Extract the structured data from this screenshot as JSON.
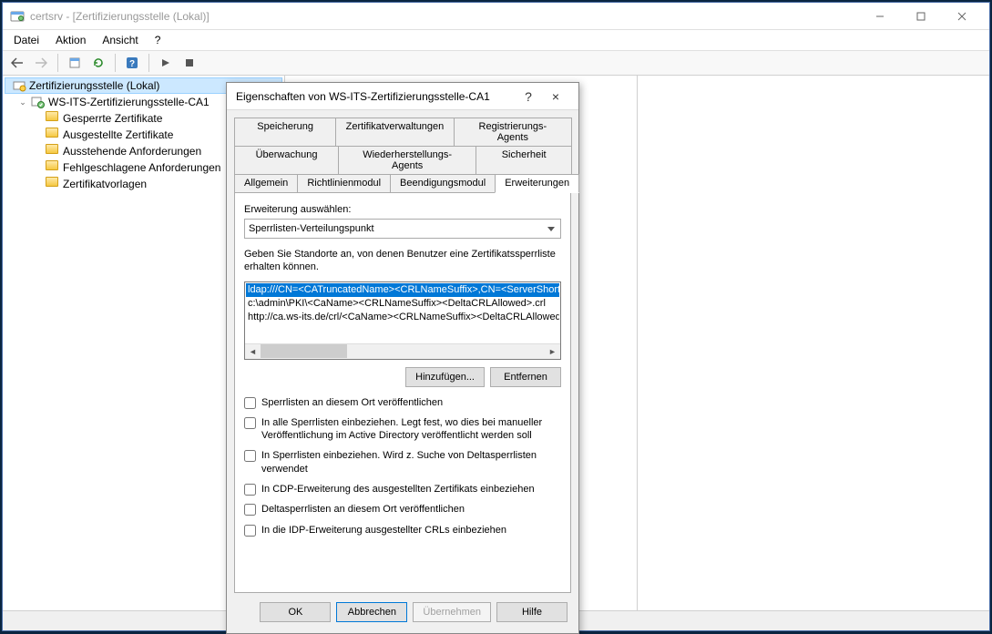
{
  "window": {
    "title_app": "certsrv",
    "title_doc": "[Zertifizierungsstelle (Lokal)]",
    "min_tip": "Minimieren",
    "max_tip": "Maximieren",
    "close_tip": "Schließen"
  },
  "menubar": {
    "file": "Datei",
    "action": "Aktion",
    "view": "Ansicht",
    "help": "?"
  },
  "tree": {
    "root": "Zertifizierungsstelle (Lokal)",
    "ca": "WS-ITS-Zertifizierungsstelle-CA1",
    "items": [
      "Gesperrte Zertifikate",
      "Ausgestellte Zertifikate",
      "Ausstehende Anforderungen",
      "Fehlgeschlagene Anforderungen",
      "Zertifikatvorlagen"
    ]
  },
  "dialog": {
    "title": "Eigenschaften von WS-ITS-Zertifizierungsstelle-CA1",
    "help_btn": "?",
    "close_btn": "×",
    "tabs_row1": [
      "Speicherung",
      "Zertifikatverwaltungen",
      "Registrierungs-Agents"
    ],
    "tabs_row2": [
      "Überwachung",
      "Wiederherstellungs-Agents",
      "Sicherheit"
    ],
    "tabs_row3": [
      "Allgemein",
      "Richtlinienmodul",
      "Beendigungsmodul",
      "Erweiterungen"
    ],
    "active_tab": "Erweiterungen",
    "ext_label": "Erweiterung auswählen:",
    "ext_combo_value": "Sperrlisten-Verteilungspunkt",
    "locations_label": "Geben Sie Standorte an, von denen Benutzer eine Zertifikatssperrliste erhalten können.",
    "list": [
      "ldap:///CN=<CATruncatedName><CRLNameSuffix>,CN=<ServerShortName>",
      "c:\\admin\\PKI\\<CaName><CRLNameSuffix><DeltaCRLAllowed>.crl",
      "http://ca.ws-its.de/crl/<CaName><CRLNameSuffix><DeltaCRLAllowed>.crl"
    ],
    "add_btn": "Hinzufügen...",
    "remove_btn": "Entfernen",
    "checks": [
      "Sperrlisten an diesem Ort veröffentlichen",
      "In alle Sperrlisten einbeziehen. Legt fest, wo dies bei manueller Veröffentlichung im Active Directory veröffentlicht werden soll",
      "In Sperrlisten einbeziehen. Wird z. Suche von Deltasperrlisten verwendet",
      "In CDP-Erweiterung des ausgestellten Zertifikats einbeziehen",
      "Deltasperrlisten an diesem Ort veröffentlichen",
      "In die IDP-Erweiterung ausgestellter CRLs einbeziehen"
    ],
    "ok": "OK",
    "cancel": "Abbrechen",
    "apply": "Übernehmen",
    "help": "Hilfe"
  }
}
